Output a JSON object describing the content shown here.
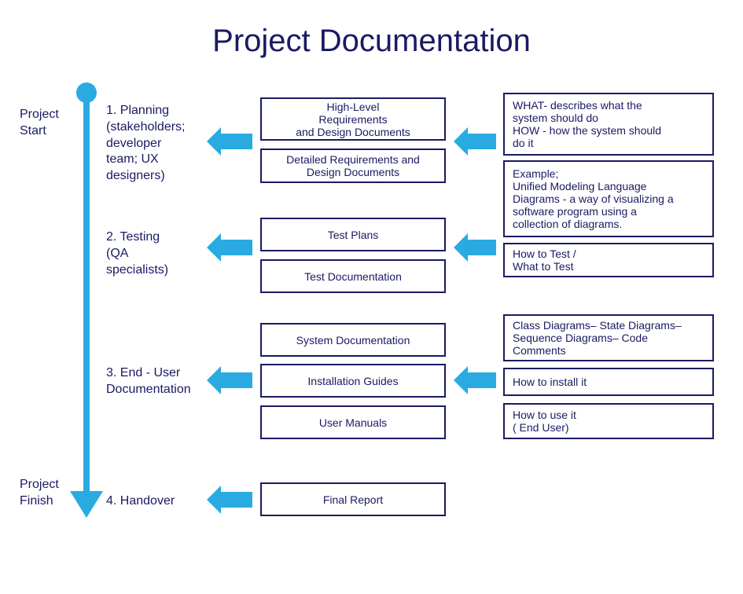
{
  "title": "Project  Documentation",
  "labels": {
    "project_start": "Project\nStart",
    "project_finish": "Project\nFinish",
    "phase1": "1. Planning\n(stakeholders;\ndeveloper\nteam; UX\ndesigners)",
    "phase2": "2. Testing\n(QA\nspecialists)",
    "phase3": "3. End - User\nDocumentation",
    "phase4": "4. Handover"
  },
  "mid": {
    "high_level": "High-Level\nRequirements\nand Design Documents",
    "detailed": "Detailed Requirements and\nDesign Documents",
    "test_plans": "Test Plans",
    "test_doc": "Test Documentation",
    "sys_doc": "System  Documentation",
    "install": "Installation Guides",
    "user_manuals": "User Manuals",
    "final_report": "Final Report"
  },
  "right": {
    "what_how": "WHAT- describes what the\nsystem should do\nHOW - how the system should\ndo it",
    "uml": "Example;\nUnified Modeling Language\nDiagrams - a way of visualizing a\nsoftware program using a\ncollection of diagrams.",
    "how_test": "How to Test /\nWhat to Test",
    "class_diag": "Class Diagrams– State Diagrams–\nSequence Diagrams– Code\nComments",
    "how_install": "How to install it",
    "how_use": "How to use it\n( End User)"
  }
}
